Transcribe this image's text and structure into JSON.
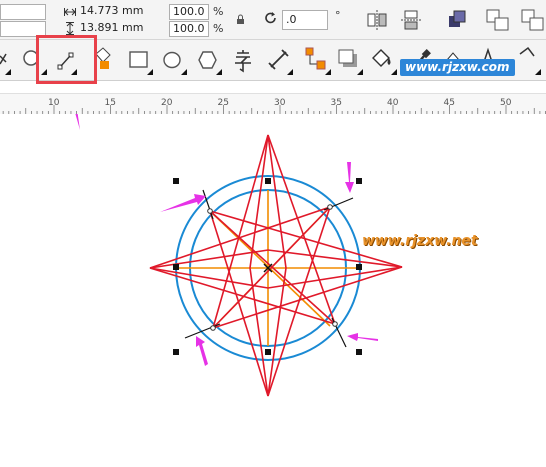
{
  "property_bar": {
    "width_value": "14.773 mm",
    "height_value": "13.891 mm",
    "scale_x": "100.0",
    "scale_y": "100.0",
    "percent_symbol": "%",
    "rotation_value": ".0",
    "degree_symbol": "°"
  },
  "ruler": {
    "ticks": [
      "10",
      "15",
      "20",
      "25",
      "30",
      "35",
      "40",
      "45",
      "50"
    ]
  },
  "watermarks": {
    "top_right": "www.rjzxw.com",
    "canvas": "www.rjzxw.net"
  },
  "colors": {
    "highlight_box": "#e8414a",
    "annotation_arrow": "#e632e6",
    "star_red": "#e0192a",
    "star_orange": "#f28c00",
    "circle_blue": "#1a8ad4",
    "wm_blue_bg": "#2d86d8",
    "wm_orange": "#e8922a"
  }
}
